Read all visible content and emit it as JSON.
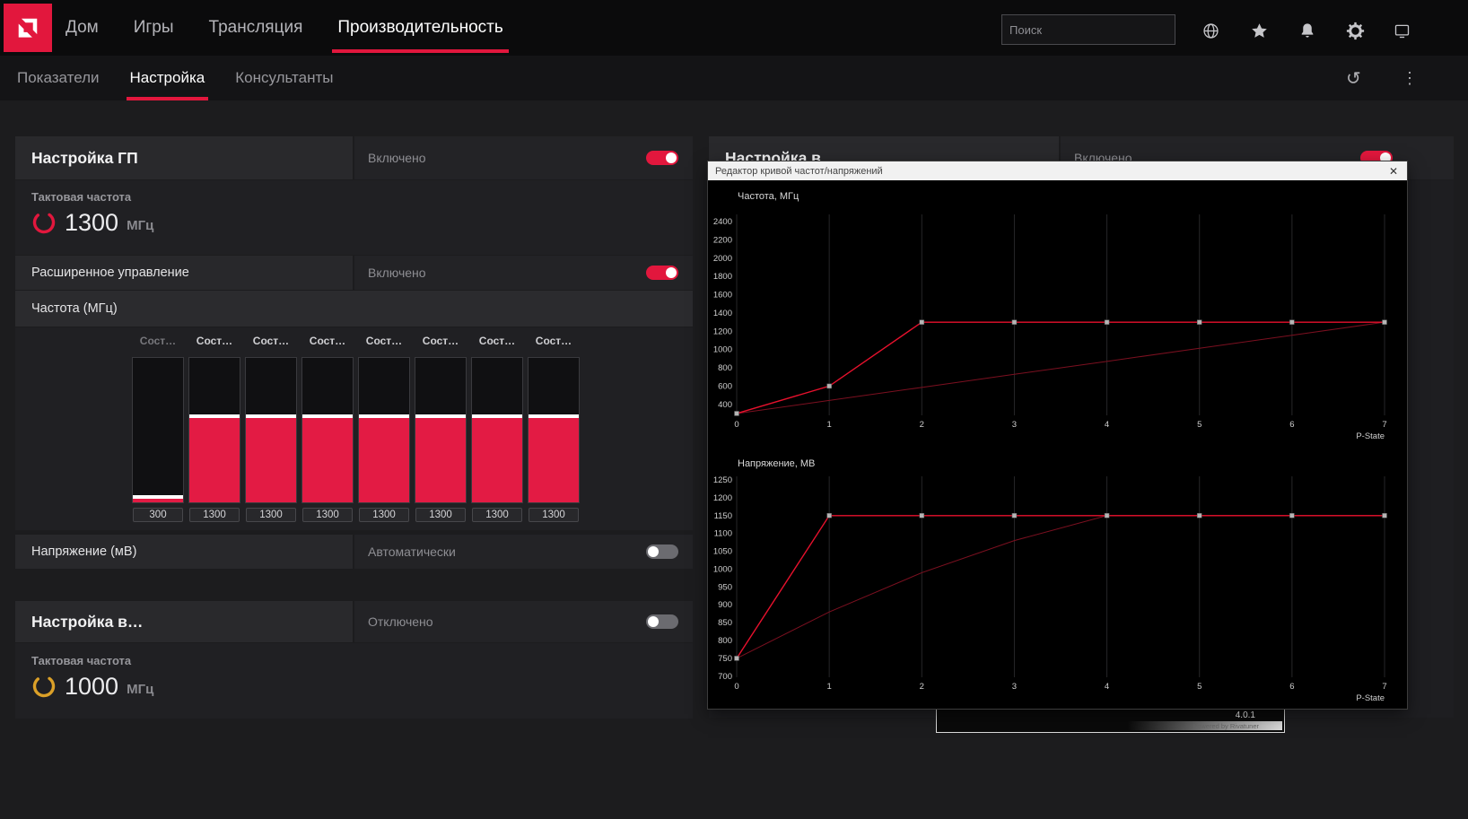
{
  "accent": "#e2173d",
  "bar_color": "#e31b44",
  "topnav": {
    "search_placeholder": "Поиск",
    "items": [
      {
        "label": "Дом"
      },
      {
        "label": "Игры"
      },
      {
        "label": "Трансляция"
      },
      {
        "label": "Производительность"
      }
    ]
  },
  "subnav": {
    "items": [
      {
        "label": "Показатели"
      },
      {
        "label": "Настройка"
      },
      {
        "label": "Консультанты"
      }
    ],
    "icons": {
      "refresh": "↺",
      "more": "⋮"
    }
  },
  "gpu_card": {
    "title": "Настройка ГП",
    "status": "Включено",
    "clock_label": "Тактовая частота",
    "clock_value": "1300",
    "clock_unit": "МГц",
    "advanced_label": "Расширенное управление",
    "advanced_status": "Включено",
    "frequency_section_label": "Частота (МГц)",
    "states": [
      {
        "header": "Сост…",
        "value": "300"
      },
      {
        "header": "Сост…",
        "value": "1300"
      },
      {
        "header": "Сост…",
        "value": "1300"
      },
      {
        "header": "Сост…",
        "value": "1300"
      },
      {
        "header": "Сост…",
        "value": "1300"
      },
      {
        "header": "Сост…",
        "value": "1300"
      },
      {
        "header": "Сост…",
        "value": "1300"
      },
      {
        "header": "Сост…",
        "value": "1300"
      }
    ],
    "voltage_label": "Напряжение (мВ)",
    "voltage_status": "Автоматически"
  },
  "vram_card": {
    "title": "Настройка в…",
    "status": "Отключено",
    "clock_label": "Тактовая частота",
    "clock_value": "1000",
    "clock_unit": "МГц"
  },
  "right_card": {
    "title": "Настройка в",
    "status": "Включено"
  },
  "curve_editor": {
    "title": "Редактор кривой частот/напряжений",
    "close_glyph": "✕"
  },
  "afterburner": {
    "version": "4.0.1",
    "powered_by": "Powered by Rivatuner"
  },
  "chart_data": [
    {
      "type": "line",
      "title": "Частота, МГц",
      "xlabel": "P-State",
      "x": [
        0,
        1,
        2,
        3,
        4,
        5,
        6,
        7
      ],
      "ylim": [
        280,
        2480
      ],
      "yticks": [
        400,
        600,
        800,
        1000,
        1200,
        1400,
        1600,
        1800,
        2000,
        2200,
        2400
      ],
      "bg": "#000000",
      "grid": "vertical",
      "legend": false,
      "marker_color": "#b5b5b5",
      "series": [
        {
          "name": "curve",
          "color": "#e8112d",
          "markers": true,
          "values": [
            300,
            600,
            1300,
            1300,
            1300,
            1300,
            1300,
            1300
          ]
        },
        {
          "name": "reference",
          "color": "#7c1020",
          "markers": false,
          "values": [
            300,
            443,
            586,
            729,
            871,
            1014,
            1157,
            1300
          ]
        }
      ]
    },
    {
      "type": "line",
      "title": "Напряжение, МВ",
      "xlabel": "P-State",
      "x": [
        0,
        1,
        2,
        3,
        4,
        5,
        6,
        7
      ],
      "ylim": [
        697,
        1260
      ],
      "yticks": [
        700,
        750,
        800,
        850,
        900,
        950,
        1000,
        1050,
        1100,
        1150,
        1200,
        1250
      ],
      "bg": "#000000",
      "grid": "vertical",
      "legend": false,
      "marker_color": "#b5b5b5",
      "series": [
        {
          "name": "curve",
          "color": "#e8112d",
          "markers": true,
          "values": [
            750,
            1150,
            1150,
            1150,
            1150,
            1150,
            1150,
            1150
          ]
        },
        {
          "name": "reference",
          "color": "#7c1020",
          "markers": false,
          "values": [
            750,
            880,
            990,
            1080,
            1150,
            1150,
            1150,
            1150
          ]
        }
      ]
    }
  ]
}
